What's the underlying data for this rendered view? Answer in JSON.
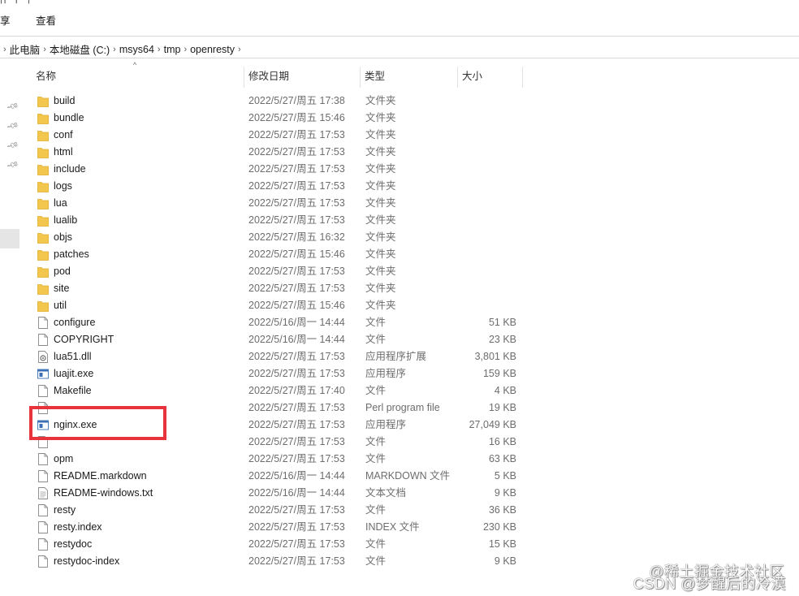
{
  "ribbon": {
    "title_fragment": "| ⎸ ⎸ |",
    "tabs": [
      "享",
      "查看"
    ]
  },
  "address_bar": {
    "crumbs": [
      "此电脑",
      "本地磁盘 (C:)",
      "msys64",
      "tmp",
      "openresty"
    ]
  },
  "columns": {
    "name": "名称",
    "modified": "修改日期",
    "type": "类型",
    "size": "大小"
  },
  "files": [
    {
      "name": "build",
      "date": "2022/5/27/周五 17:38",
      "type": "文件夹",
      "size": "",
      "icon": "folder"
    },
    {
      "name": "bundle",
      "date": "2022/5/27/周五 15:46",
      "type": "文件夹",
      "size": "",
      "icon": "folder"
    },
    {
      "name": "conf",
      "date": "2022/5/27/周五 17:53",
      "type": "文件夹",
      "size": "",
      "icon": "folder"
    },
    {
      "name": "html",
      "date": "2022/5/27/周五 17:53",
      "type": "文件夹",
      "size": "",
      "icon": "folder"
    },
    {
      "name": "include",
      "date": "2022/5/27/周五 17:53",
      "type": "文件夹",
      "size": "",
      "icon": "folder"
    },
    {
      "name": "logs",
      "date": "2022/5/27/周五 17:53",
      "type": "文件夹",
      "size": "",
      "icon": "folder"
    },
    {
      "name": "lua",
      "date": "2022/5/27/周五 17:53",
      "type": "文件夹",
      "size": "",
      "icon": "folder"
    },
    {
      "name": "lualib",
      "date": "2022/5/27/周五 17:53",
      "type": "文件夹",
      "size": "",
      "icon": "folder"
    },
    {
      "name": "objs",
      "date": "2022/5/27/周五 16:32",
      "type": "文件夹",
      "size": "",
      "icon": "folder"
    },
    {
      "name": "patches",
      "date": "2022/5/27/周五 15:46",
      "type": "文件夹",
      "size": "",
      "icon": "folder"
    },
    {
      "name": "pod",
      "date": "2022/5/27/周五 17:53",
      "type": "文件夹",
      "size": "",
      "icon": "folder"
    },
    {
      "name": "site",
      "date": "2022/5/27/周五 17:53",
      "type": "文件夹",
      "size": "",
      "icon": "folder"
    },
    {
      "name": "util",
      "date": "2022/5/27/周五 15:46",
      "type": "文件夹",
      "size": "",
      "icon": "folder"
    },
    {
      "name": "configure",
      "date": "2022/5/16/周一 14:44",
      "type": "文件",
      "size": "51 KB",
      "icon": "file"
    },
    {
      "name": "COPYRIGHT",
      "date": "2022/5/16/周一 14:44",
      "type": "文件",
      "size": "23 KB",
      "icon": "file"
    },
    {
      "name": "lua51.dll",
      "date": "2022/5/27/周五 17:53",
      "type": "应用程序扩展",
      "size": "3,801 KB",
      "icon": "dll"
    },
    {
      "name": "luajit.exe",
      "date": "2022/5/27/周五 17:53",
      "type": "应用程序",
      "size": "159 KB",
      "icon": "exe"
    },
    {
      "name": "Makefile",
      "date": "2022/5/27/周五 17:40",
      "type": "文件",
      "size": "4 KB",
      "icon": "file"
    },
    {
      "name": "",
      "date": "2022/5/27/周五 17:53",
      "type": "Perl program file",
      "size": "19 KB",
      "icon": "file"
    },
    {
      "name": "nginx.exe",
      "date": "2022/5/27/周五 17:53",
      "type": "应用程序",
      "size": "27,049 KB",
      "icon": "exe"
    },
    {
      "name": "",
      "date": "2022/5/27/周五 17:53",
      "type": "文件",
      "size": "16 KB",
      "icon": "file"
    },
    {
      "name": "opm",
      "date": "2022/5/27/周五 17:53",
      "type": "文件",
      "size": "63 KB",
      "icon": "file"
    },
    {
      "name": "README.markdown",
      "date": "2022/5/16/周一 14:44",
      "type": "MARKDOWN 文件",
      "size": "5 KB",
      "icon": "file"
    },
    {
      "name": "README-windows.txt",
      "date": "2022/5/16/周一 14:44",
      "type": "文本文档",
      "size": "9 KB",
      "icon": "txt"
    },
    {
      "name": "resty",
      "date": "2022/5/27/周五 17:53",
      "type": "文件",
      "size": "36 KB",
      "icon": "file"
    },
    {
      "name": "resty.index",
      "date": "2022/5/27/周五 17:53",
      "type": "INDEX 文件",
      "size": "230 KB",
      "icon": "file"
    },
    {
      "name": "restydoc",
      "date": "2022/5/27/周五 17:53",
      "type": "文件",
      "size": "15 KB",
      "icon": "file"
    },
    {
      "name": "restydoc-index",
      "date": "2022/5/27/周五 17:53",
      "type": "文件",
      "size": "9 KB",
      "icon": "file"
    }
  ],
  "watermark": {
    "line1": "@稀土掘金技术社区",
    "line2": "CSDN @梦醒后的冷漠"
  },
  "colors": {
    "folder": "#f3c74d",
    "highlight_box": "#e8323c"
  }
}
